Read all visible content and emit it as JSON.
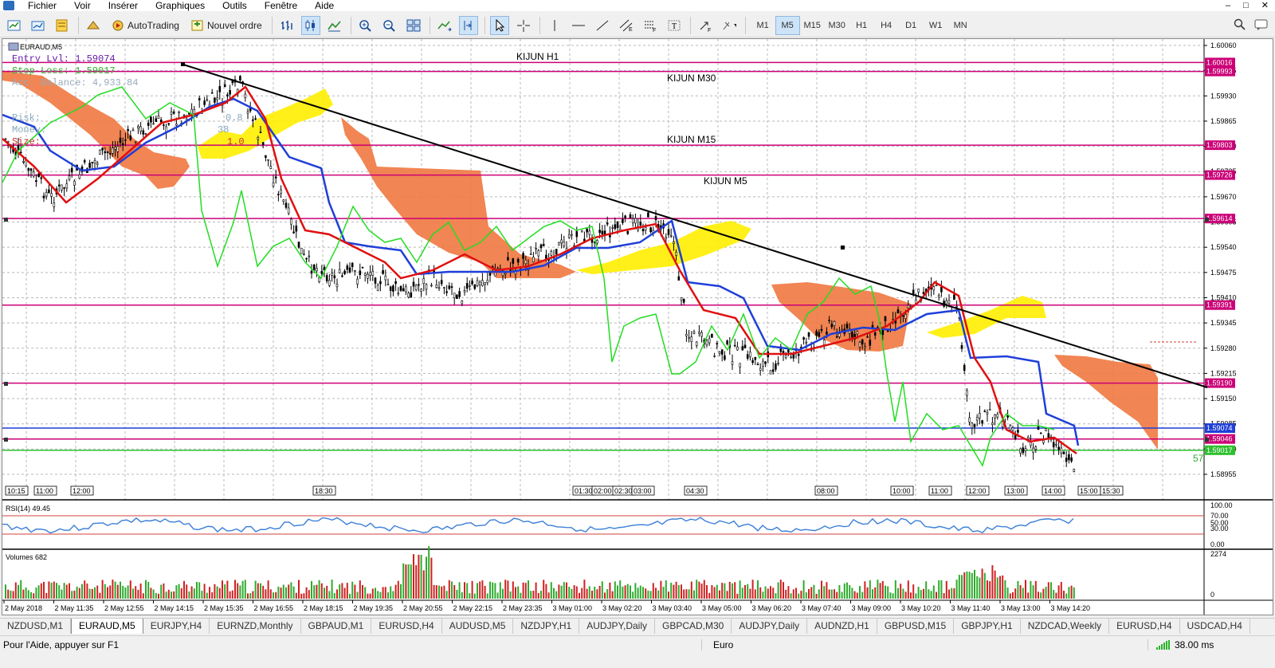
{
  "menu": [
    "Fichier",
    "Voir",
    "Insérer",
    "Graphiques",
    "Outils",
    "Fenêtre",
    "Aide"
  ],
  "window_controls": [
    "‒",
    "□",
    "✕"
  ],
  "toolbar": {
    "autotrading_label": "AutoTrading",
    "new_order_label": "Nouvel ordre",
    "timeframes": [
      "M1",
      "M5",
      "M15",
      "M30",
      "H1",
      "H4",
      "D1",
      "W1",
      "MN"
    ],
    "active_timeframe": "M5"
  },
  "chart": {
    "symbol_title": "EURAUD,M5",
    "info": {
      "entry": "Entry Lvl:    1.59074",
      "stop": "Stop Loss:    1.59017",
      "balance": "Acc. Balance: 4,933.84",
      "risk": "Risk:",
      "money": "Money:",
      "size": "Size:",
      "risk_val": "0.8",
      "money_val": "38",
      "size_val": "1.0"
    },
    "kijun_labels": [
      "KIJUN H1",
      "KIJUN M30",
      "KIJUN M15",
      "KIJUN M5"
    ],
    "price_scale": [
      "1.60060",
      "1.59995",
      "1.59930",
      "1.59865",
      "1.59800",
      "1.59735",
      "1.59670",
      "1.59605",
      "1.59540",
      "1.59475",
      "1.59410",
      "1.59345",
      "1.59280",
      "1.59215",
      "1.59150",
      "1.59085",
      "1.59020",
      "1.58955"
    ],
    "hlines": [
      {
        "price": "1.60016",
        "color": "#cc0077"
      },
      {
        "price": "1.59993",
        "color": "#cc0077"
      },
      {
        "price": "1.59803",
        "color": "#cc0077"
      },
      {
        "price": "1.59726",
        "color": "#cc0077"
      },
      {
        "price": "1.59614",
        "color": "#cc0077"
      },
      {
        "price": "1.59391",
        "color": "#cc0077"
      },
      {
        "price": "1.59190",
        "color": "#cc0077"
      },
      {
        "price": "1.59074",
        "color": "#1f3fd8"
      },
      {
        "price": "1.59046",
        "color": "#cc0077"
      },
      {
        "price": "1.59017",
        "color": "#2ec02e"
      }
    ],
    "side_label": "57",
    "time_markers": [
      "10:15",
      "11:00",
      "12:00",
      "18:30",
      "01:30",
      "02:00",
      "02:30",
      "03:00",
      "04:30",
      "08:00",
      "10:00",
      "11:00",
      "12:00",
      "13:00",
      "14:00",
      "15:00",
      "15:30"
    ],
    "time_axis": [
      "2 May 2018",
      "2 May 11:35",
      "2 May 12:55",
      "2 May 14:15",
      "2 May 15:35",
      "2 May 16:55",
      "2 May 18:15",
      "2 May 19:35",
      "2 May 20:55",
      "2 May 22:15",
      "2 May 23:35",
      "3 May 01:00",
      "3 May 02:20",
      "3 May 03:40",
      "3 May 05:00",
      "3 May 06:20",
      "3 May 07:40",
      "3 May 09:00",
      "3 May 10:20",
      "3 May 11:40",
      "3 May 13:00",
      "3 May 14:20"
    ],
    "rsi_label": "RSI(14) 49.45",
    "rsi_scale": [
      "100.00",
      "70.00",
      "50.00",
      "30.00",
      "0.00"
    ],
    "volume_label": "Volumes 682",
    "volume_scale": [
      "2274",
      "0"
    ]
  },
  "tabs": [
    "NZDUSD,M1",
    "EURAUD,M5",
    "EURJPY,H4",
    "EURNZD,Monthly",
    "GBPAUD,M1",
    "EURUSD,H4",
    "AUDUSD,M5",
    "NZDJPY,H1",
    "AUDJPY,Daily",
    "GBPCAD,M30",
    "AUDJPY,Daily",
    "AUDNZD,H1",
    "GBPUSD,M15",
    "GBPJPY,H1",
    "NZDCAD,Weekly",
    "EURUSD,H4",
    "USDCAD,H4"
  ],
  "active_tab": 1,
  "status": {
    "help": "Pour l'Aide, appuyer sur F1",
    "symbol": "Euro",
    "ping": "38.00 ms"
  },
  "colors": {
    "cloud_bull": "#ffee00",
    "cloud_bear": "#f07840",
    "kijun": "#1f3fd8",
    "tenkan": "#e01010",
    "chikou": "#22dd22",
    "trendline": "#000000",
    "hline": "#cc0077",
    "rsi": "#3a7fd8"
  }
}
